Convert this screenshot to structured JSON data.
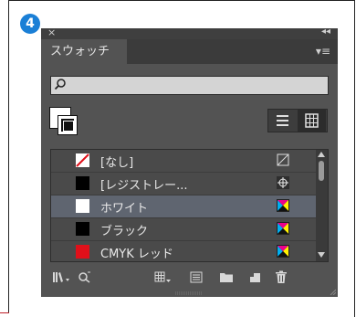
{
  "badge": {
    "number": "4",
    "color": "#1a7fd6"
  },
  "panel": {
    "tab_label": "スウォッチ",
    "search_placeholder": "",
    "swatches": [
      {
        "name": "[なし]",
        "color": "none",
        "type_icon": "none-icon",
        "selected": false
      },
      {
        "name": "[レジストレー...",
        "color": "#000000",
        "type_icon": "registration-icon",
        "selected": false
      },
      {
        "name": "ホワイト",
        "color": "#ffffff",
        "type_icon": "cmyk-process-icon",
        "selected": true
      },
      {
        "name": "ブラック",
        "color": "#000000",
        "type_icon": "cmyk-process-icon",
        "selected": false
      },
      {
        "name": "CMYK レッド",
        "color": "#e0101a",
        "type_icon": "cmyk-process-icon",
        "selected": false
      }
    ]
  },
  "colors": {
    "panel_bg": "#535353",
    "selected_row": "#5f6570",
    "text": "#e8e8e8"
  },
  "icons": {
    "close": "close-icon",
    "collapse": "collapse-icon",
    "panel_menu": "panel-menu-icon",
    "search": "search-icon",
    "list_view": "list-view-icon",
    "grid_view": "grid-view-icon",
    "bottom": [
      "swatch-libraries-icon",
      "place-swatch-icon",
      "show-kinds-icon",
      "swatch-options-icon",
      "new-color-group-icon",
      "new-swatch-icon",
      "delete-swatch-icon"
    ]
  }
}
